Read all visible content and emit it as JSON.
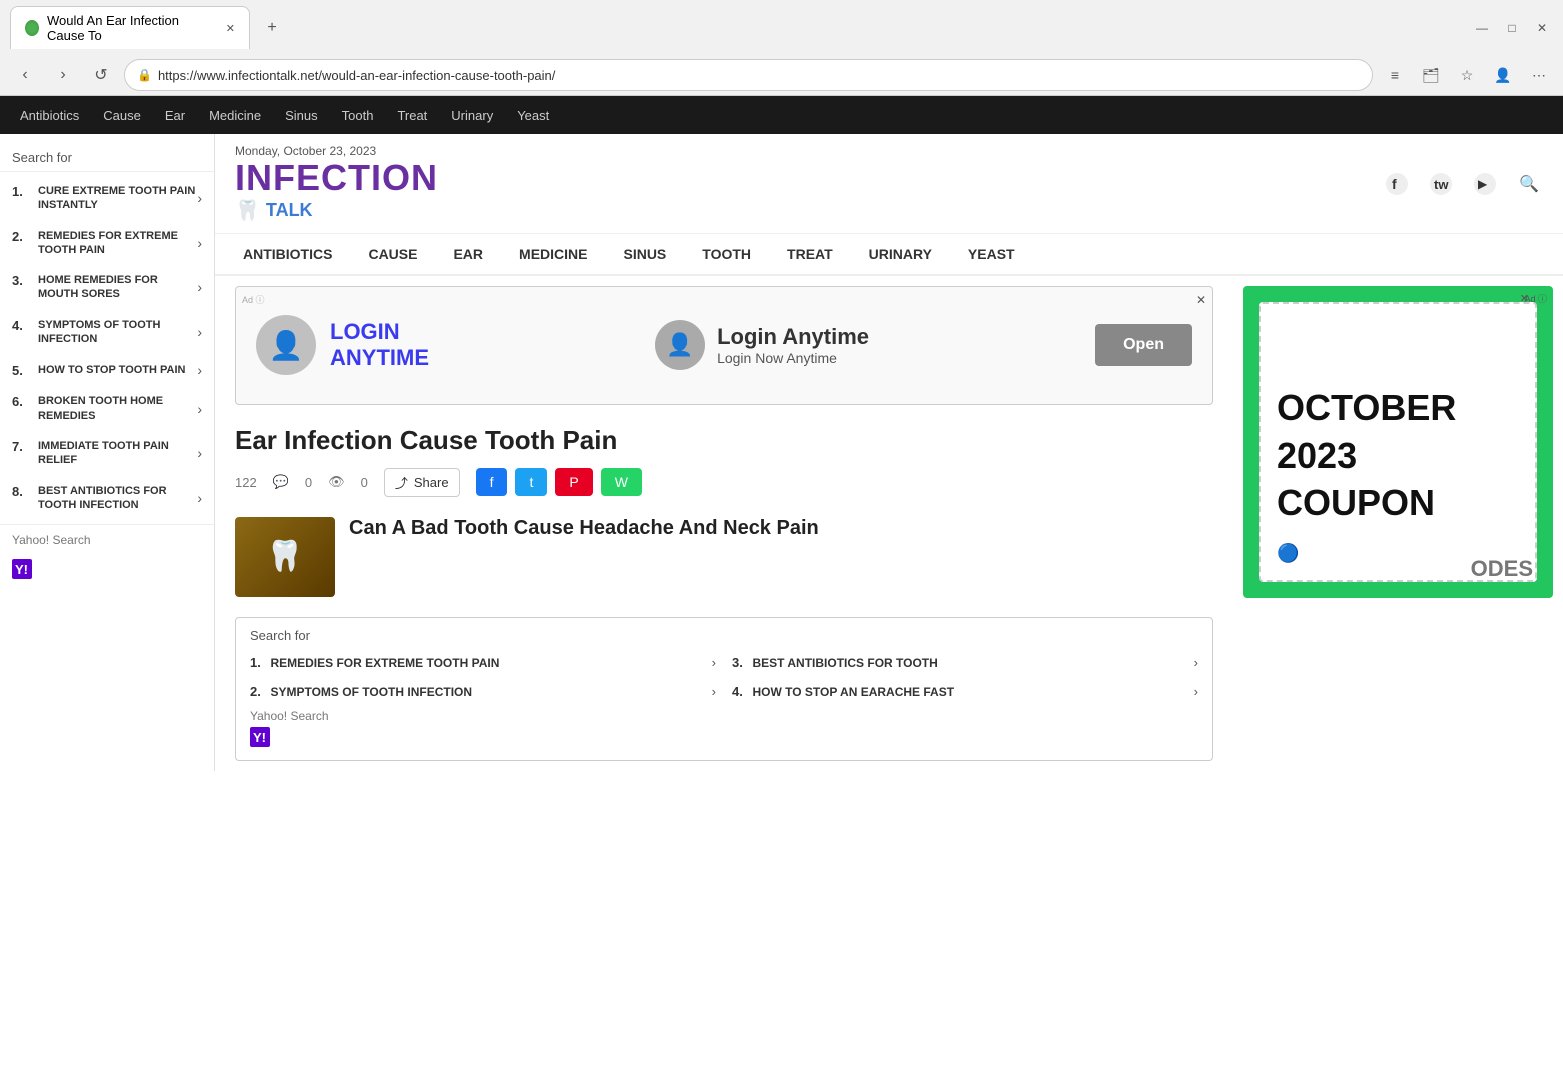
{
  "browser": {
    "tab_title": "Would An Ear Infection Cause To",
    "url": "https://www.infectiontalk.net/would-an-ear-infection-cause-tooth-pain/",
    "new_tab_label": "+",
    "back_btn": "‹",
    "forward_btn": "›",
    "refresh_btn": "↺"
  },
  "top_nav": {
    "items": [
      "Antibiotics",
      "Cause",
      "Ear",
      "Medicine",
      "Sinus",
      "Tooth",
      "Treat",
      "Urinary",
      "Yeast"
    ]
  },
  "site": {
    "date": "Monday, October 23, 2023",
    "logo_infection": "INFECTION",
    "logo_talk": "TALK"
  },
  "secondary_nav": {
    "items": [
      "ANTIBIOTICS",
      "CAUSE",
      "EAR",
      "MEDICINE",
      "SINUS",
      "TOOTH",
      "TREAT",
      "URINARY",
      "YEAST"
    ]
  },
  "sidebar": {
    "search_label": "Search for",
    "items": [
      {
        "num": "1.",
        "label": "CURE EXTREME TOOTH PAIN INSTANTLY"
      },
      {
        "num": "2.",
        "label": "REMEDIES FOR EXTREME TOOTH PAIN"
      },
      {
        "num": "3.",
        "label": "HOME REMEDIES FOR MOUTH SORES"
      },
      {
        "num": "4.",
        "label": "SYMPTOMS OF TOOTH INFECTION"
      },
      {
        "num": "5.",
        "label": "HOW TO STOP TOOTH PAIN"
      },
      {
        "num": "6.",
        "label": "BROKEN TOOTH HOME REMEDIES"
      },
      {
        "num": "7.",
        "label": "IMMEDIATE TOOTH PAIN RELIEF"
      },
      {
        "num": "8.",
        "label": "BEST ANTIBIOTICS FOR TOOTH INFECTION"
      }
    ]
  },
  "ad_banner": {
    "login_text": "LOGIN\nANYTIME",
    "title": "Login Anytime",
    "subtitle": "Login Now Anytime",
    "open_btn": "Open"
  },
  "article": {
    "title": "Ear Infection Cause Tooth Pain",
    "meta_date": "122",
    "comments": "0",
    "views": "0",
    "share_label": "Share"
  },
  "article_card": {
    "title": "Can A Bad Tooth Cause Headache And Neck Pain"
  },
  "inline_search": {
    "label": "Search for",
    "yahoo_label": "Yahoo! Search",
    "results": [
      {
        "num": "1.",
        "text": "REMEDIES FOR EXTREME TOOTH PAIN"
      },
      {
        "num": "2.",
        "text": "SYMPTOMS OF TOOTH INFECTION"
      },
      {
        "num": "3.",
        "text": "BEST ANTIBIOTICS FOR TOOTH"
      },
      {
        "num": "4.",
        "text": "HOW TO STOP AN EARACHE FAST"
      }
    ]
  },
  "ad_right": {
    "month": "OCTOBER",
    "year": "2023",
    "label": "COUPON",
    "brand_suffix": "ODES"
  },
  "icons": {
    "chevron": "›",
    "facebook": "f",
    "twitter": "t",
    "pinterest": "p",
    "whatsapp": "w",
    "share": "⤴",
    "search": "🔍",
    "lock": "🔒",
    "profile": "👤",
    "menu": "⋯",
    "close": "✕",
    "minimize": "—",
    "maximize": "□"
  }
}
